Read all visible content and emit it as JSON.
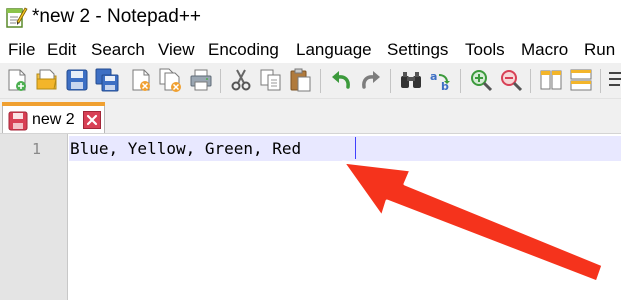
{
  "window": {
    "title": "*new 2 - Notepad++",
    "app_icon": "notepad-plus-plus-icon"
  },
  "menu": {
    "items": [
      "File",
      "Edit",
      "Search",
      "View",
      "Encoding",
      "Language",
      "Settings",
      "Tools",
      "Macro",
      "Run"
    ]
  },
  "toolbar": {
    "buttons": [
      "new-file-icon",
      "open-file-icon",
      "save-icon",
      "save-all-icon",
      "close-icon",
      "close-all-icon",
      "print-icon",
      "cut-icon",
      "copy-icon",
      "paste-icon",
      "undo-icon",
      "redo-icon",
      "find-icon",
      "replace-icon",
      "zoom-in-icon",
      "zoom-out-icon",
      "sync-vertical-icon",
      "sync-horizontal-icon",
      "word-wrap-icon"
    ]
  },
  "tabs": [
    {
      "label": "new 2",
      "modified": true,
      "active": true,
      "icon": "unsaved-floppy-icon",
      "close_icon": "tab-close-icon"
    }
  ],
  "editor": {
    "lines": [
      {
        "number": "1",
        "text": "Blue, Yellow, Green, Red"
      }
    ],
    "current_line_color": "#e8e8ff",
    "caret_color": "#4040ff"
  },
  "annotation": {
    "type": "arrow",
    "color": "#f5331c",
    "points_to": "end-of-line-1"
  },
  "colors": {
    "toolbar_bg": "#f0f0f0",
    "gutter_bg": "#e4e4e4",
    "tab_accent": "#f0a030",
    "tab_close": "#d84055"
  }
}
